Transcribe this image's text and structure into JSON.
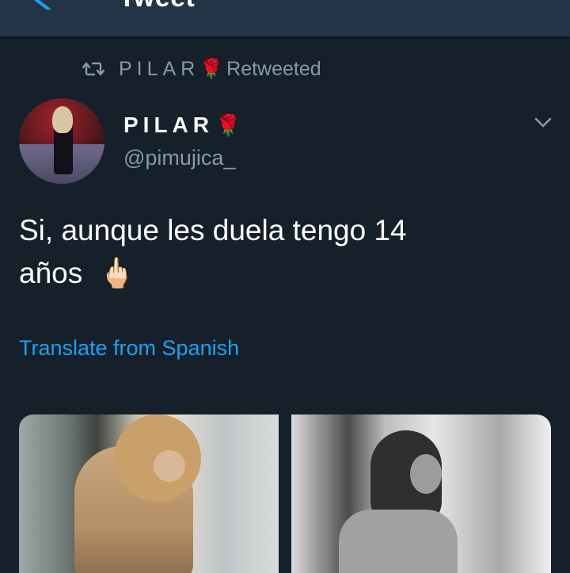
{
  "header": {
    "title": "Tweet"
  },
  "retweet": {
    "name": "PILAR",
    "rose": "🌹",
    "label": "Retweeted"
  },
  "author": {
    "display_name": "PILAR",
    "rose": "🌹",
    "handle": "@pimujica_"
  },
  "tweet": {
    "text_line1": "Si, aunque les duela tengo 14",
    "text_line2": "años",
    "emoji": "🖕🏻",
    "translate": "Translate from Spanish"
  },
  "icons": {
    "back": "back-arrow-icon",
    "retweet": "retweet-icon",
    "menu": "chevron-down-icon"
  },
  "colors": {
    "background": "#15202b",
    "header": "#243447",
    "secondary_text": "#8899a6",
    "link": "#1da1f2"
  }
}
